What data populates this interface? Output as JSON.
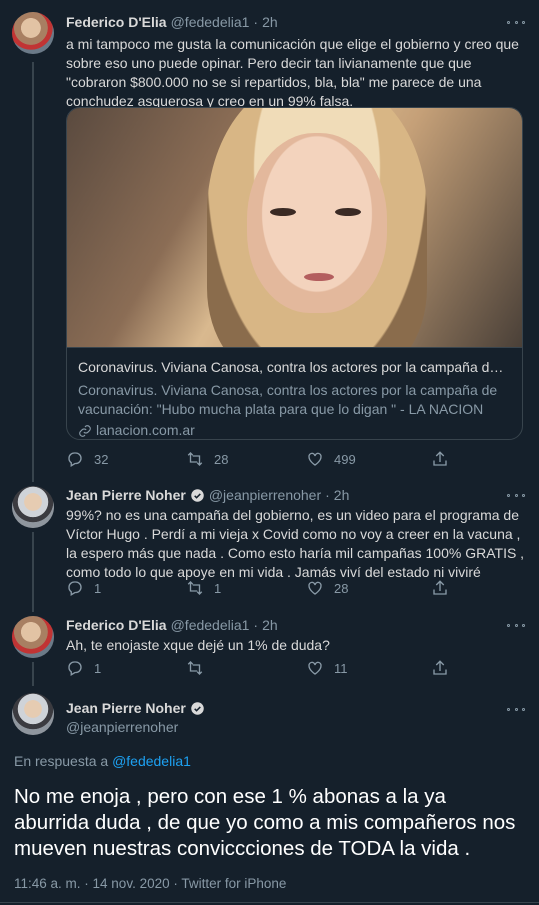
{
  "tweet1": {
    "name": "Federico D'Elia",
    "handle": "@fededelia1",
    "separator": "·",
    "time": "2h",
    "text": "a mi tampoco me gusta la comunicación que elige el gobierno y creo que sobre eso uno puede opinar. Pero decir tan livianamente que que \"cobraron $800.000 no se si repartidos, bla, bla\" me parece de una conchudez asquerosa y creo en un 99% falsa.",
    "card": {
      "title": "Coronavirus. Viviana Canosa, contra los actores por la campaña de vacunación: \"Hubo mucha plata para que lo digan \"",
      "description": "Coronavirus. Viviana Canosa, contra los actores por la campaña de vacunación: \"Hubo mucha plata para que lo digan \" - LA NACION",
      "domain": "lanacion.com.ar"
    },
    "replies": "32",
    "retweets": "28",
    "likes": "499"
  },
  "tweet2": {
    "name": "Jean Pierre Noher",
    "handle": "@jeanpierrenoher",
    "separator": "·",
    "time": "2h",
    "text": "99%? no es una campaña del gobierno, es un video para el programa  de Víctor Hugo . Perdí a mi vieja x Covid como no voy a creer en la vacuna , la espero más que nada . Como esto haría mil campañas 100% GRATIS , como todo lo que apoye en mi vida . Jamás viví del estado ni viviré",
    "replies": "1",
    "retweets": "1",
    "likes": "28"
  },
  "tweet3": {
    "name": "Federico D'Elia",
    "handle": "@fededelia1",
    "separator": "·",
    "time": "2h",
    "text": "Ah, te enojaste xque dejé un 1% de duda?",
    "replies": "1",
    "retweets": "",
    "likes": "11"
  },
  "main_tweet": {
    "name": "Jean Pierre Noher",
    "handle": "@jeanpierrenoher",
    "reply_prefix": "En respuesta a",
    "reply_to": "@fededelia1",
    "text": "No me enoja , pero con ese 1 % abonas  a la ya aburrida duda , de que yo como a mis compañeros nos mueven nuestras conviccciones de TODA la vida .",
    "timestamp": "11:46 a. m. · 14 nov. 2020 · Twitter for iPhone"
  },
  "colors": {
    "background": "#15202b",
    "accent": "#1da1f2",
    "muted": "#8899a6",
    "border": "#38444d"
  }
}
